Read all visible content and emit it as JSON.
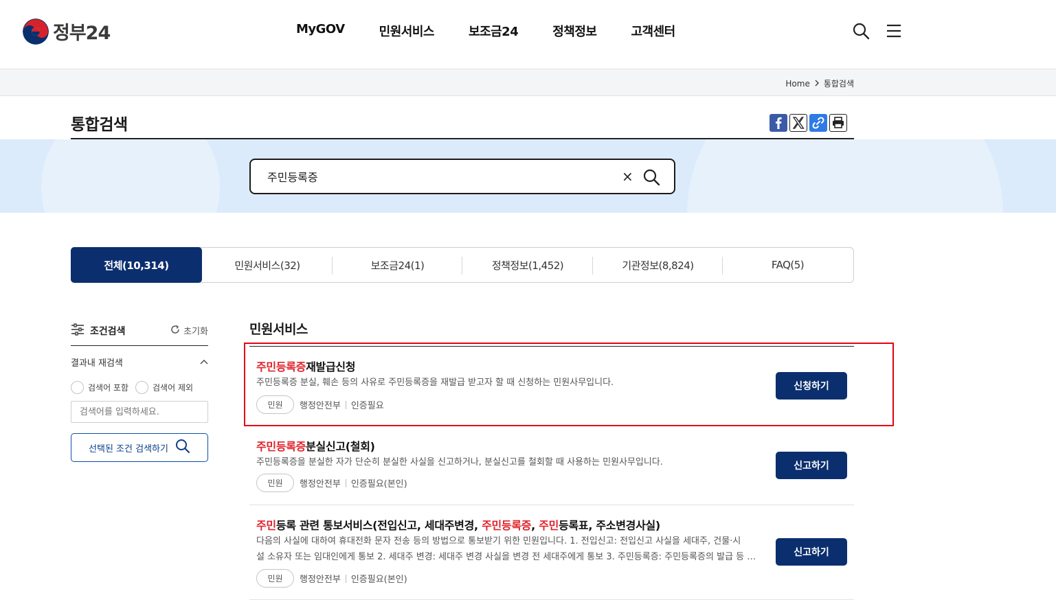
{
  "header": {
    "logo_text": "정부24",
    "nav": [
      "MyGOV",
      "민원서비스",
      "보조금24",
      "정책정보",
      "고객센터"
    ]
  },
  "breadcrumb": {
    "home": "Home",
    "current": "통합검색"
  },
  "page": {
    "title": "통합검색"
  },
  "search": {
    "query": "주민등록증",
    "clear_symbol": "×"
  },
  "tabs": [
    {
      "label": "전체(10,314)",
      "active": true
    },
    {
      "label": "민원서비스(32)"
    },
    {
      "label": "보조금24(1)"
    },
    {
      "label": "정책정보(1,452)"
    },
    {
      "label": "기관정보(8,824)"
    },
    {
      "label": "FAQ(5)"
    }
  ],
  "filter": {
    "title": "조건검색",
    "reset": "초기화",
    "sub_title": "결과내 재검색",
    "radio_include": "검색어 포함",
    "radio_exclude": "검색어 제외",
    "input_placeholder": "검색어를 입력하세요.",
    "submit_label": "선택된 조건 검색하기"
  },
  "section": {
    "title": "민원서비스"
  },
  "results": [
    {
      "title_hl": "주민등록증",
      "title_rest": "재발급신청",
      "desc": "주민등록증 분실, 훼손 등의 사유로 주민등록증을 재발급 받고자 할 때 신청하는 민원사무입니다.",
      "tag": "민원",
      "agency": "행정안전부",
      "auth": "인증필요",
      "button": "신청하기"
    },
    {
      "title_hl": "주민등록증",
      "title_rest": "분실신고(철회)",
      "desc": "주민등록증을 분실한 자가 단순히 분실한 사실을 신고하거나, 분실신고를 철회할 때 사용하는 민원사무입니다.",
      "tag": "민원",
      "agency": "행정안전부",
      "auth": "인증필요(본인)",
      "button": "신고하기"
    },
    {
      "title_parts": {
        "p1": "주민",
        "p2": "등록 관련 통보서비스(전입신고, 세대주변경, ",
        "p3": "주민등록증",
        "p4": ", ",
        "p5": "주민",
        "p6": "등록표, 주소변경사실)"
      },
      "desc_line1": "다음의 사실에 대하여 휴대전화 문자 전송 등의 방법으로 통보받기 위한 민원입니다. 1. 전입신고: 전입신고 사실을 세대주, 건물·시",
      "desc_line2": "설 소유자 또는 임대인에게 통보 2. 세대주 변경: 세대주 변경 사실을 변경 전 세대주에게 통보 3. 주민등록증: 주민등록증의 발급 등 사실을 통보",
      "tag": "민원",
      "agency": "행정안전부",
      "auth": "인증필요(본인)",
      "button": "신고하기"
    }
  ],
  "colors": {
    "primary": "#0b2f6e",
    "highlight": "#e0232b",
    "band": "#dcebfb",
    "annotation": "#e60012"
  }
}
